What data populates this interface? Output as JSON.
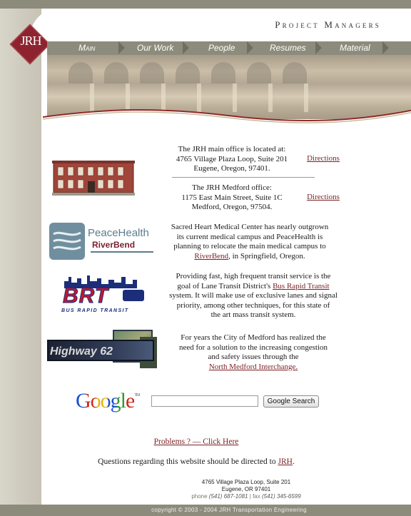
{
  "header": {
    "tagline": "Project Managers",
    "logo_text": "JRH"
  },
  "nav": {
    "items": [
      {
        "label": "Main"
      },
      {
        "label": "Our Work"
      },
      {
        "label": "People"
      },
      {
        "label": "Resumes"
      },
      {
        "label": "Material"
      }
    ]
  },
  "offices": {
    "main": {
      "line1": "The JRH main office is located at:",
      "line2": "4765 Village Plaza Loop, Suite 201",
      "line3": "Eugene, Oregon, 97401.",
      "directions": "Directions"
    },
    "medford": {
      "line1": "The JRH Medford office:",
      "line2": "1175 East Main Street, Suite 1C",
      "line3": "Medford, Oregon, 97504.",
      "directions": "Directions"
    }
  },
  "projects": {
    "peacehealth": {
      "logo_line1": "PeaceHealth",
      "logo_line2": "RiverBend",
      "line1": "Sacred Heart Medical Center has nearly outgrown",
      "line2": "its current medical campus and PeaceHealth is",
      "line3": "planning to relocate the main medical campus to",
      "link": "RiverBend",
      "line4_rest": ", in Springfield, Oregon."
    },
    "brt": {
      "logo_text": "BRT",
      "logo_sub": "BUS RAPID TRANSIT",
      "line1": "Providing fast, high frequent transit service is the",
      "line2_pre": "goal of Lane Transit District's ",
      "link": "Bus Rapid Transit",
      "line3": "system. It will make use of exclusive lanes and signal",
      "line4": "priority, among other techniques, for this state of",
      "line5": "the art mass transit system."
    },
    "highway": {
      "logo_text": "Highway 62",
      "line1": "For years the City of Medford has realized the",
      "line2": "need for a solution to the increasing congestion",
      "line3": "and safety issues through the",
      "link": "North Medford Interchange."
    }
  },
  "search": {
    "logo": "Google",
    "button": "Google Search",
    "value": ""
  },
  "help": {
    "problems_link": "Problems ? — Click Here",
    "questions_pre": "Questions regarding this website should be directed to ",
    "questions_link": "JRH",
    "questions_post": "."
  },
  "footer": {
    "addr1": "4765 Village Plaza Loop, Suite 201",
    "addr2": "Eugene, OR 97401",
    "phone_label": "phone",
    "phone": "(541) 687-1081",
    "fax_label": "fax",
    "fax": "(541) 345-6599",
    "copyright": "copyright © 2003 - 2004 JRH Transportation Engineering"
  },
  "colors": {
    "link": "#7a1f23",
    "bar": "#8d8c7c",
    "logo": "#8e2330"
  }
}
